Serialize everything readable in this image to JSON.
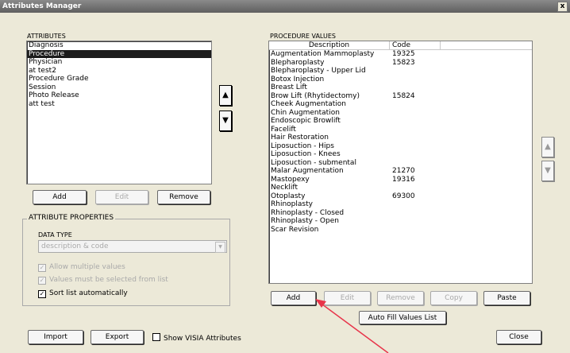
{
  "window": {
    "title": "Attributes Manager",
    "close_glyph": "x"
  },
  "attributes": {
    "label": "ATTRIBUTES",
    "items": [
      "Diagnosis",
      "Procedure",
      "Physician",
      "at test2",
      "Procedure Grade",
      "Session",
      "Photo Release",
      "att test"
    ],
    "selected_index": 1,
    "add_label": "Add",
    "edit_label": "Edit",
    "remove_label": "Remove",
    "move_up_glyph": "▲",
    "move_down_glyph": "▼"
  },
  "properties": {
    "legend": "ATTRIBUTE PROPERTIES",
    "data_type_label": "DATA TYPE",
    "data_type_value": "description & code",
    "dropdown_glyph": "▼",
    "allow_multiple": {
      "label": "Allow multiple values",
      "checked": true
    },
    "must_select": {
      "label": "Values must be selected from list",
      "checked": true
    },
    "sort_auto": {
      "label": "Sort list automatically",
      "checked": true
    },
    "check_glyph": "✓"
  },
  "procedure_values": {
    "label": "PROCEDURE VALUES",
    "col_description": "Description",
    "col_code": "Code",
    "rows": [
      {
        "description": "Augmentation Mammoplasty",
        "code": "19325"
      },
      {
        "description": "Blepharoplasty",
        "code": "15823"
      },
      {
        "description": "Blepharoplasty - Upper Lid",
        "code": ""
      },
      {
        "description": "Botox Injection",
        "code": ""
      },
      {
        "description": "Breast Lift",
        "code": ""
      },
      {
        "description": "Brow Lift (Rhytidectomy)",
        "code": "15824"
      },
      {
        "description": "Cheek Augmentation",
        "code": ""
      },
      {
        "description": "Chin Augmentation",
        "code": ""
      },
      {
        "description": "Endoscopic Browlift",
        "code": ""
      },
      {
        "description": "Facelift",
        "code": ""
      },
      {
        "description": "Hair Restoration",
        "code": ""
      },
      {
        "description": "Liposuction - Hips",
        "code": ""
      },
      {
        "description": "Liposuction - Knees",
        "code": ""
      },
      {
        "description": "Liposuction - submental",
        "code": ""
      },
      {
        "description": "Malar Augmentation",
        "code": "21270"
      },
      {
        "description": "Mastopexy",
        "code": "19316"
      },
      {
        "description": "Necklift",
        "code": ""
      },
      {
        "description": "Otoplasty",
        "code": "69300"
      },
      {
        "description": "Rhinoplasty",
        "code": ""
      },
      {
        "description": "Rhinoplasty - Closed",
        "code": ""
      },
      {
        "description": "Rhinoplasty - Open",
        "code": ""
      },
      {
        "description": "Scar Revision",
        "code": ""
      }
    ],
    "add_label": "Add",
    "edit_label": "Edit",
    "remove_label": "Remove",
    "copy_label": "Copy",
    "paste_label": "Paste",
    "autofill_label": "Auto Fill Values List",
    "move_up_glyph": "▲",
    "move_down_glyph": "▼"
  },
  "footer": {
    "import_label": "Import",
    "export_label": "Export",
    "show_visia": {
      "label": "Show VISIA Attributes",
      "checked": false
    },
    "close_label": "Close"
  },
  "annotation": {
    "arrow_color": "#e8344a"
  }
}
